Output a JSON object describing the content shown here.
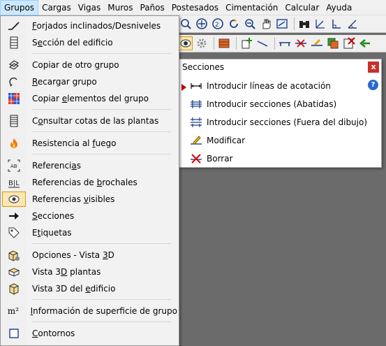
{
  "menubar": {
    "items": [
      "Grupos",
      "Cargas",
      "Vigas",
      "Muros",
      "Paños",
      "Postesados",
      "Cimentación",
      "Calcular",
      "Ayuda"
    ]
  },
  "dropdown": {
    "items": [
      {
        "pre": "",
        "acc": "F",
        "post": "orjados inclinados/Desniveles",
        "icon": "slope-icon"
      },
      {
        "pre": "S",
        "acc": "e",
        "post": "cción del edificio",
        "icon": "building-section-icon"
      },
      {
        "pre": "Copiar de otro ",
        "acc": "g",
        "post": "rupo",
        "icon": "copy-group-icon"
      },
      {
        "pre": "",
        "acc": "R",
        "post": "ecargar grupo",
        "icon": "reload-icon"
      },
      {
        "pre": "Copiar ",
        "acc": "e",
        "post": "lementos del grupo",
        "icon": "copy-elements-icon"
      },
      {
        "pre": "C",
        "acc": "o",
        "post": "nsultar cotas de las plantas",
        "icon": "floor-levels-icon"
      },
      {
        "pre": "Resistencia al ",
        "acc": "f",
        "post": "uego",
        "icon": "fire-icon"
      },
      {
        "pre": "Referenci",
        "acc": "a",
        "post": "s",
        "icon": "references-icon"
      },
      {
        "pre": "Referencias de ",
        "acc": "b",
        "post": "rochales",
        "icon": "trimmer-references-icon"
      },
      {
        "pre": "Referencias ",
        "acc": "v",
        "post": "isibles",
        "icon": "visible-references-icon"
      },
      {
        "pre": "",
        "acc": "S",
        "post": "ecciones",
        "icon": "arrow-right-icon"
      },
      {
        "pre": "E",
        "acc": "t",
        "post": "iquetas",
        "icon": "tag-icon"
      },
      {
        "pre": "Opciones - Vista ",
        "acc": "3",
        "post": "D",
        "icon": "3d-options-icon"
      },
      {
        "pre": "Vista 3",
        "acc": "D",
        "post": " plantas",
        "icon": "3d-floors-icon"
      },
      {
        "pre": "Vista 3D del ",
        "acc": "e",
        "post": "dificio",
        "icon": "3d-building-icon"
      },
      {
        "pre": "",
        "acc": "I",
        "post": "nformación de superficie de grupo",
        "icon": "area-m2-icon"
      },
      {
        "pre": "",
        "acc": "C",
        "post": "ontornos",
        "icon": "contour-icon"
      }
    ]
  },
  "panel": {
    "title": "Secciones",
    "close": "x",
    "help": "?",
    "items": [
      {
        "label": "Introducir líneas de acotación",
        "icon": "dimension-line-icon"
      },
      {
        "label": "Introducir secciones (Abatidas)",
        "icon": "section-folded-icon"
      },
      {
        "label": "Introducir secciones (Fuera del dibujo)",
        "icon": "section-outside-icon"
      },
      {
        "label": "Modificar",
        "icon": "modify-icon"
      },
      {
        "label": "Borrar",
        "icon": "delete-icon"
      }
    ]
  },
  "icon_labels": {
    "references": "AB",
    "trimmers": "B|L",
    "area": "m²"
  }
}
